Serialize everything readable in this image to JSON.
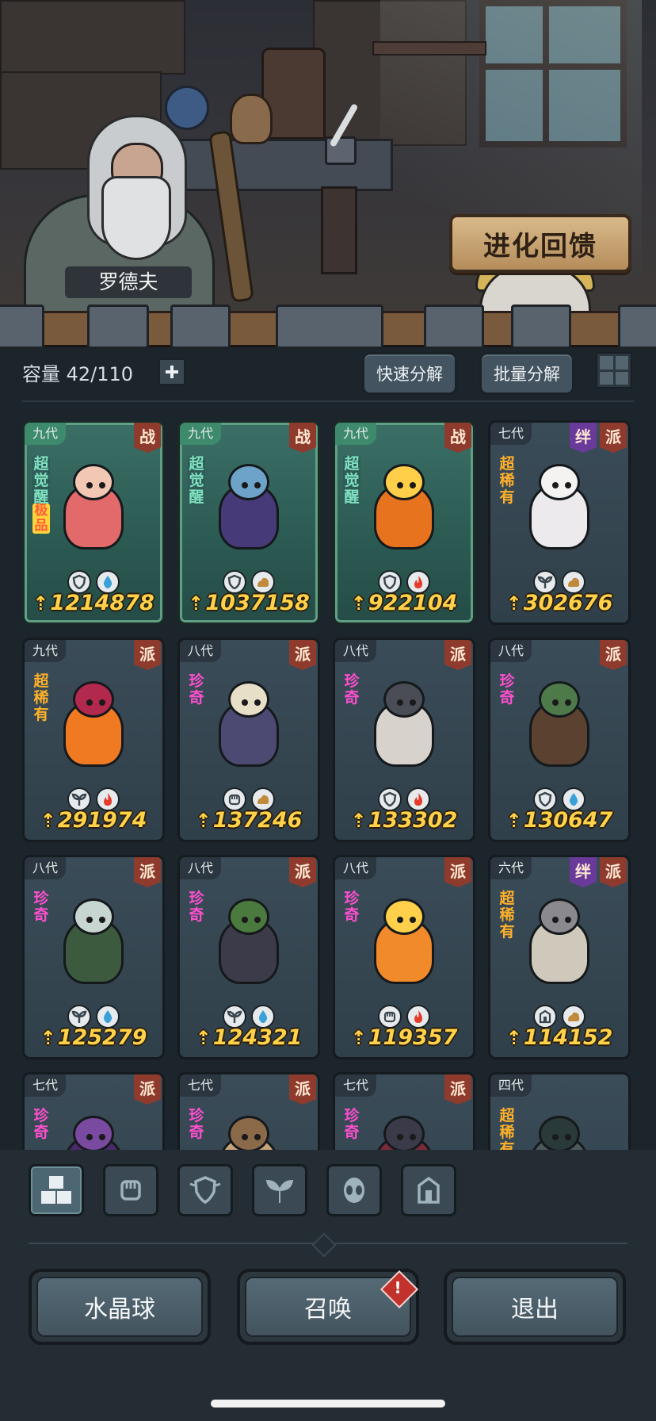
{
  "scene": {
    "npc_name": "罗德夫",
    "evolution_button": "进化回馈"
  },
  "inventory": {
    "capacity_label": "容量 42/110",
    "quick_decompose": "快速分解",
    "batch_decompose": "批量分解"
  },
  "cards": [
    {
      "gen": "九代",
      "badges": [
        {
          "text": "战",
          "color": "red"
        }
      ],
      "rarity": "超觉醒",
      "rarity2": "极品",
      "style": "teal",
      "elements": [
        "shield",
        "water"
      ],
      "power": "1214878",
      "palette": [
        "#e26a6a",
        "#f2c7b3"
      ]
    },
    {
      "gen": "九代",
      "badges": [
        {
          "text": "战",
          "color": "red"
        }
      ],
      "rarity": "超觉醒",
      "style": "teal",
      "elements": [
        "shield",
        "earth"
      ],
      "power": "1037158",
      "palette": [
        "#463a78",
        "#6ea3c9"
      ]
    },
    {
      "gen": "九代",
      "badges": [
        {
          "text": "战",
          "color": "red"
        }
      ],
      "rarity": "超觉醒",
      "style": "teal",
      "elements": [
        "shield",
        "fire"
      ],
      "power": "922104",
      "palette": [
        "#e8731f",
        "#ffcf4a"
      ]
    },
    {
      "gen": "七代",
      "badges": [
        {
          "text": "派",
          "color": "red"
        },
        {
          "text": "绊",
          "color": "purple"
        }
      ],
      "rarity": "超稀有",
      "rarity_class": "super",
      "style": "plain",
      "elements": [
        "leaf",
        "earth"
      ],
      "power": "302676",
      "palette": [
        "#eceaec",
        "#f5f3f2"
      ]
    },
    {
      "gen": "九代",
      "badges": [
        {
          "text": "派",
          "color": "red"
        }
      ],
      "rarity": "超稀有",
      "rarity_class": "super",
      "style": "plain",
      "elements": [
        "leaf",
        "fire"
      ],
      "power": "291974",
      "palette": [
        "#f07a22",
        "#b3284d"
      ]
    },
    {
      "gen": "八代",
      "badges": [
        {
          "text": "派",
          "color": "red"
        }
      ],
      "rarity": "珍奇",
      "rarity_class": "rare",
      "style": "plain",
      "elements": [
        "fist",
        "earth"
      ],
      "power": "137246",
      "palette": [
        "#4c4a72",
        "#e8dfc9"
      ]
    },
    {
      "gen": "八代",
      "badges": [
        {
          "text": "派",
          "color": "red"
        }
      ],
      "rarity": "珍奇",
      "rarity_class": "rare",
      "style": "plain",
      "elements": [
        "shield",
        "fire"
      ],
      "power": "133302",
      "palette": [
        "#d8d2cc",
        "#4a4d55"
      ]
    },
    {
      "gen": "八代",
      "badges": [
        {
          "text": "派",
          "color": "red"
        }
      ],
      "rarity": "珍奇",
      "rarity_class": "rare",
      "style": "plain",
      "elements": [
        "shield",
        "water"
      ],
      "power": "130647",
      "palette": [
        "#5a4130",
        "#4e7a4a"
      ]
    },
    {
      "gen": "八代",
      "badges": [
        {
          "text": "派",
          "color": "red"
        }
      ],
      "rarity": "珍奇",
      "rarity_class": "rare",
      "style": "plain",
      "elements": [
        "leaf",
        "water"
      ],
      "power": "125279",
      "palette": [
        "#3c5a3e",
        "#c8d6d2"
      ]
    },
    {
      "gen": "八代",
      "badges": [
        {
          "text": "派",
          "color": "red"
        }
      ],
      "rarity": "珍奇",
      "rarity_class": "rare",
      "style": "plain",
      "elements": [
        "leaf",
        "water"
      ],
      "power": "124321",
      "palette": [
        "#3b3b4a",
        "#4a7a3e"
      ]
    },
    {
      "gen": "八代",
      "badges": [
        {
          "text": "派",
          "color": "red"
        }
      ],
      "rarity": "珍奇",
      "rarity_class": "rare",
      "style": "plain",
      "elements": [
        "fist",
        "fire"
      ],
      "power": "119357",
      "palette": [
        "#f08a2a",
        "#ffd04a"
      ]
    },
    {
      "gen": "六代",
      "badges": [
        {
          "text": "派",
          "color": "red"
        },
        {
          "text": "绊",
          "color": "purple"
        }
      ],
      "rarity": "超稀有",
      "rarity_class": "super",
      "style": "plain",
      "elements": [
        "tower",
        "earth"
      ],
      "power": "114152",
      "palette": [
        "#cfc9bc",
        "#8a8a8e"
      ]
    },
    {
      "gen": "七代",
      "badges": [
        {
          "text": "派",
          "color": "red"
        }
      ],
      "rarity": "珍奇",
      "rarity_class": "rare",
      "style": "plain",
      "elements": [],
      "power": "",
      "palette": [
        "#4a2a6a",
        "#7a4aa0"
      ]
    },
    {
      "gen": "七代",
      "badges": [
        {
          "text": "派",
          "color": "red"
        }
      ],
      "rarity": "珍奇",
      "rarity_class": "rare",
      "style": "plain",
      "elements": [],
      "power": "",
      "palette": [
        "#c7a37a",
        "#8a6a48"
      ]
    },
    {
      "gen": "七代",
      "badges": [
        {
          "text": "派",
          "color": "red"
        }
      ],
      "rarity": "珍奇",
      "rarity_class": "rare",
      "style": "plain",
      "elements": [],
      "power": "",
      "palette": [
        "#7a2a3a",
        "#3a3a48"
      ]
    },
    {
      "gen": "四代",
      "badges": [],
      "rarity": "超稀有",
      "rarity_class": "super",
      "style": "plain",
      "elements": [],
      "power": "",
      "palette": [
        "#4a5a5a",
        "#2a3a3a"
      ]
    }
  ],
  "filters": [
    {
      "icon": "all-blocks-icon",
      "active": true
    },
    {
      "icon": "fist-icon",
      "active": false
    },
    {
      "icon": "shield-icon",
      "active": false
    },
    {
      "icon": "leaf-icon",
      "active": false
    },
    {
      "icon": "alien-icon",
      "active": false
    },
    {
      "icon": "tower-icon",
      "active": false
    }
  ],
  "bottom_buttons": {
    "crystal_ball": "水晶球",
    "summon": "召唤",
    "exit": "退出",
    "summon_alert": "!"
  },
  "colors": {
    "power_text": "#ffd24a",
    "badge_red": "#8e3b2e",
    "badge_purple": "#6a3a9b",
    "rarity_super": "#ffb02a",
    "rarity_rare": "#ff4fd0",
    "rarity_awakened": "#7fe1c0"
  }
}
